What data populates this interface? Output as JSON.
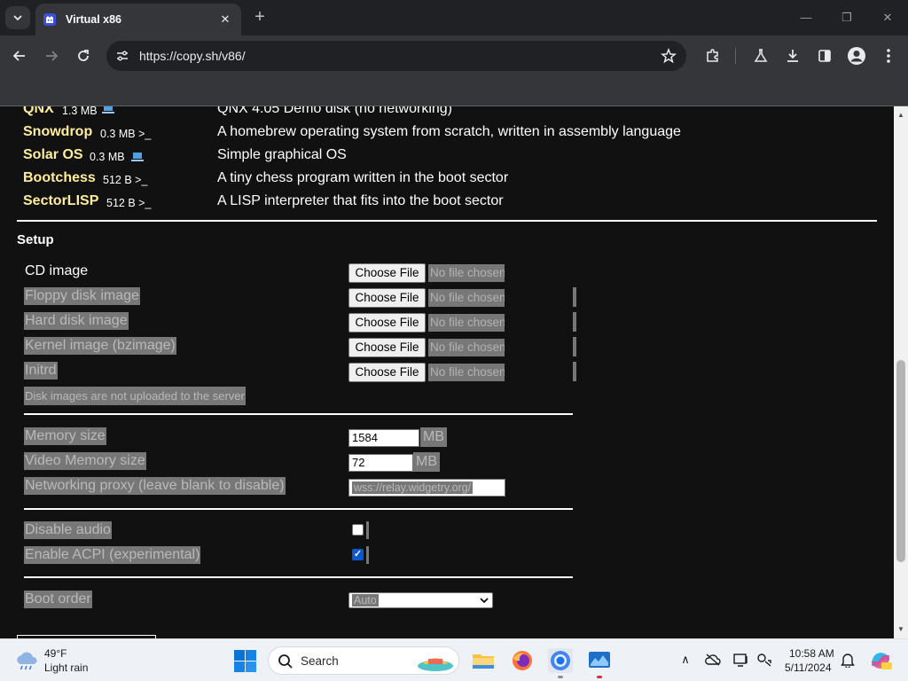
{
  "browser": {
    "tab_title": "Virtual x86",
    "tab_close": "✕",
    "new_tab": "+",
    "url": "https://copy.sh/v86/",
    "window_controls": {
      "minimize": "—",
      "restore": "❐",
      "close": "✕"
    }
  },
  "os_list": [
    {
      "name": "QNX",
      "size": "1.3 MB",
      "kind": "laptop",
      "description": "QNX 4.05 Demo disk (no networking)"
    },
    {
      "name": "Snowdrop",
      "size": "0.3 MB >_",
      "kind": "terminal",
      "description": "A homebrew operating system from scratch, written in assembly language"
    },
    {
      "name": "Solar OS",
      "size": "0.3 MB",
      "kind": "laptop",
      "description": "Simple graphical OS"
    },
    {
      "name": "Bootchess",
      "size": "512 B >_",
      "kind": "terminal",
      "description": "A tiny chess program written in the boot sector"
    },
    {
      "name": "SectorLISP",
      "size": "512 B >_",
      "kind": "terminal",
      "description": "A LISP interpreter that fits into the boot sector"
    }
  ],
  "setup": {
    "title": "Setup",
    "file_inputs": [
      {
        "label": "CD image",
        "button": "Choose File",
        "status": "No file chosen"
      },
      {
        "label": "Floppy disk image",
        "button": "Choose File",
        "status": "No file chosen"
      },
      {
        "label": "Hard disk image",
        "button": "Choose File",
        "status": "No file chosen"
      },
      {
        "label": "Kernel image (bzimage)",
        "button": "Choose File",
        "status": "No file chosen"
      },
      {
        "label": "Initrd",
        "button": "Choose File",
        "status": "No file chosen"
      }
    ],
    "upload_note": "Disk images are not uploaded to the server",
    "memory": {
      "label": "Memory size",
      "value": "1584",
      "unit": "MB"
    },
    "video_memory": {
      "label": "Video Memory size",
      "value": "72",
      "unit": "MB"
    },
    "network": {
      "label": "Networking proxy (leave blank to disable)",
      "value": "wss://relay.widgetry.org/"
    },
    "disable_audio": {
      "label": "Disable audio",
      "checked": false
    },
    "acpi": {
      "label": "Enable ACPI (experimental)",
      "checked": true,
      "check_glyph": "✓"
    },
    "boot_order": {
      "label": "Boot order",
      "value": "Auto",
      "arrow": "⌄"
    }
  },
  "taskbar": {
    "weather_temp": "49°F",
    "weather_desc": "Light rain",
    "search_placeholder": "Search",
    "time": "10:58 AM",
    "date": "5/11/2024",
    "tray_chevron": "∧"
  },
  "colors": {
    "page_bg": "#111111",
    "os_name": "#ffee99",
    "dim_label_bg": "#777777",
    "chrome_bg": "#35363a",
    "taskbar_bg": "#eef1f6"
  }
}
